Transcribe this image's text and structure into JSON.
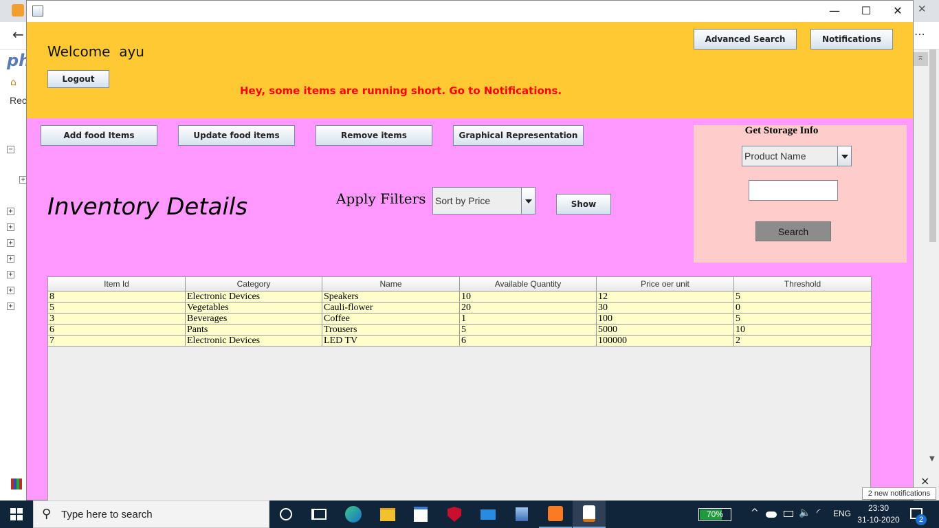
{
  "window": {
    "minimize_glyph": "—",
    "maximize_glyph": "☐",
    "close_glyph": "✕"
  },
  "header": {
    "welcome_label": "Welcome",
    "username": "ayu",
    "logout_label": "Logout",
    "alert_text": "Hey, some items are running short. Go to Notifications.",
    "alert_color": "#ff0000",
    "advanced_search_label": "Advanced Search",
    "notifications_label": "Notifications",
    "background_color": "#ffc933"
  },
  "actions": {
    "add_label": "Add food Items",
    "update_label": "Update food items",
    "remove_label": "Remove items",
    "graph_label": "Graphical Representation"
  },
  "main": {
    "title": "Inventory Details",
    "background_color": "#ff99ff"
  },
  "filters": {
    "label": "Apply Filters",
    "selected": "Sort by Price",
    "show_label": "Show"
  },
  "storage": {
    "title": "Get Storage Info",
    "selected": "Product Name",
    "input_value": "",
    "search_label": "Search",
    "panel_color": "#ffcccc"
  },
  "table": {
    "columns": [
      "Item Id",
      "Category",
      "Name",
      "Available Quantity",
      "Price oer unit",
      "Threshold"
    ],
    "rows": [
      [
        "8",
        "Electronic Devices",
        "Speakers",
        "10",
        "12",
        "5"
      ],
      [
        "5",
        "Vegetables",
        "Cauli-flower",
        "20",
        "30",
        "0"
      ],
      [
        "3",
        "Beverages",
        "Coffee",
        "1",
        "100",
        "5"
      ],
      [
        "6",
        "Pants",
        "Trousers",
        "5",
        "5000",
        "10"
      ],
      [
        "7",
        "Electronic Devices",
        "LED TV",
        "6",
        "100000",
        "2"
      ]
    ]
  },
  "background_app": {
    "logo_text": "ph",
    "nav_text": "Rec"
  },
  "taskbar": {
    "search_placeholder": "Type here to search",
    "battery": "70%",
    "language": "ENG",
    "time": "23:30",
    "date": "31-10-2020",
    "notification_count": "2",
    "toast": "2 new notifications",
    "toast_close": "×"
  }
}
